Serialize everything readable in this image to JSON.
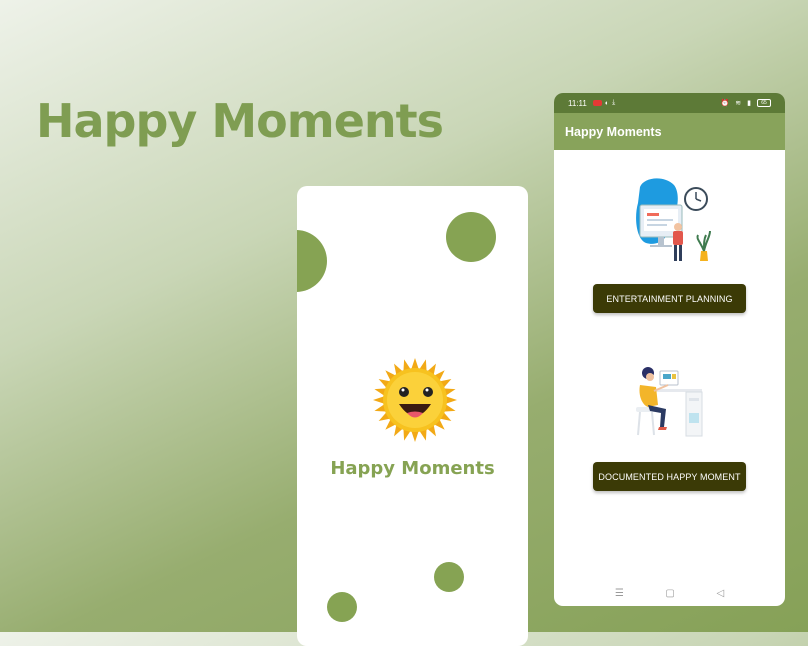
{
  "hero": {
    "title": "Happy Moments"
  },
  "splash": {
    "app_name": "Happy Moments"
  },
  "app": {
    "status_bar": {
      "time": "11:11",
      "battery": "65"
    },
    "toolbar": {
      "title": "Happy Moments"
    },
    "buttons": {
      "entertainment_planning": "ENTERTAINMENT PLANNING",
      "documented_happy_moment": "DOCUMENTED HAPPY MOMENT"
    },
    "nav": {
      "menu": "☰",
      "home": "▢",
      "back": "◁"
    }
  },
  "colors": {
    "accent_green": "#86a353",
    "status_bar": "#5d7a37",
    "button_dark": "#3b3a06",
    "sun_yellow": "#f5b81c"
  }
}
